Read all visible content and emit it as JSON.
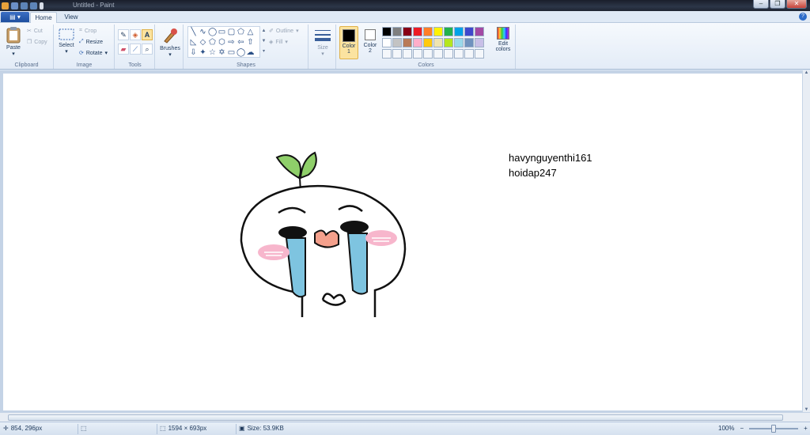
{
  "window": {
    "title": "Untitled - Paint",
    "minimize": "–",
    "maximize": "❐",
    "close": "✕"
  },
  "tabs": {
    "app_menu": "▤ ▾",
    "home": "Home",
    "view": "View",
    "help": "?"
  },
  "ribbon": {
    "clipboard": {
      "group": "Clipboard",
      "paste": "Paste",
      "cut": "Cut",
      "copy": "Copy"
    },
    "image": {
      "group": "Image",
      "select": "Select",
      "crop": "Crop",
      "resize": "Resize",
      "rotate": "Rotate"
    },
    "tools": {
      "group": "Tools"
    },
    "brushes": {
      "label": "Brushes"
    },
    "shapes": {
      "group": "Shapes",
      "outline": "Outline",
      "fill": "Fill"
    },
    "size": {
      "label": "Size"
    },
    "colors": {
      "group": "Colors",
      "color1_label": "Color",
      "color1_num": "1",
      "color2_label": "Color",
      "color2_num": "2",
      "edit_colors": "Edit",
      "edit_colors2": "colors",
      "color1": "#000000",
      "color2": "#ffffff",
      "palette_row1": [
        "#000000",
        "#7f7f7f",
        "#880015",
        "#ed1c24",
        "#ff7f27",
        "#fff200",
        "#22b14c",
        "#00a2e8",
        "#3f48cc",
        "#a349a4"
      ],
      "palette_row2": [
        "#ffffff",
        "#c3c3c3",
        "#b97a57",
        "#ffaec9",
        "#ffc90e",
        "#efe4b0",
        "#b5e61d",
        "#99d9ea",
        "#7092be",
        "#c8bfe7"
      ]
    }
  },
  "canvas": {
    "text_line1": "havynguyenthi161",
    "text_line2": "hoidap247"
  },
  "status": {
    "cursor_pos": "854, 296px",
    "dimensions": "1594 × 693px",
    "size": "Size: 53.9KB",
    "zoom": "100%",
    "zoom_out": "−",
    "zoom_in": "+"
  }
}
